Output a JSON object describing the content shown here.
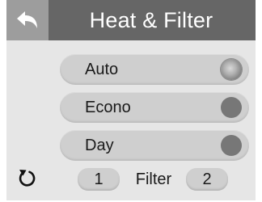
{
  "header": {
    "title": "Heat & Filter",
    "back_icon": "back-arrow-icon"
  },
  "modes": [
    {
      "label": "Auto",
      "selected": true
    },
    {
      "label": "Econo",
      "selected": false
    },
    {
      "label": "Day",
      "selected": false
    }
  ],
  "footer": {
    "reset_icon": "reset-icon",
    "filter_label": "Filter",
    "filter_one_label": "1",
    "filter_two_label": "2"
  },
  "colors": {
    "screen_background": "#e6e6e6",
    "header_background": "#666666",
    "back_button_background": "#9d9d9d",
    "button_background": "#cfcfcf",
    "indicator_off": "#777777",
    "indicator_on": "#c2c2c2",
    "text": "#1a1a1a",
    "header_text": "#ffffff"
  }
}
